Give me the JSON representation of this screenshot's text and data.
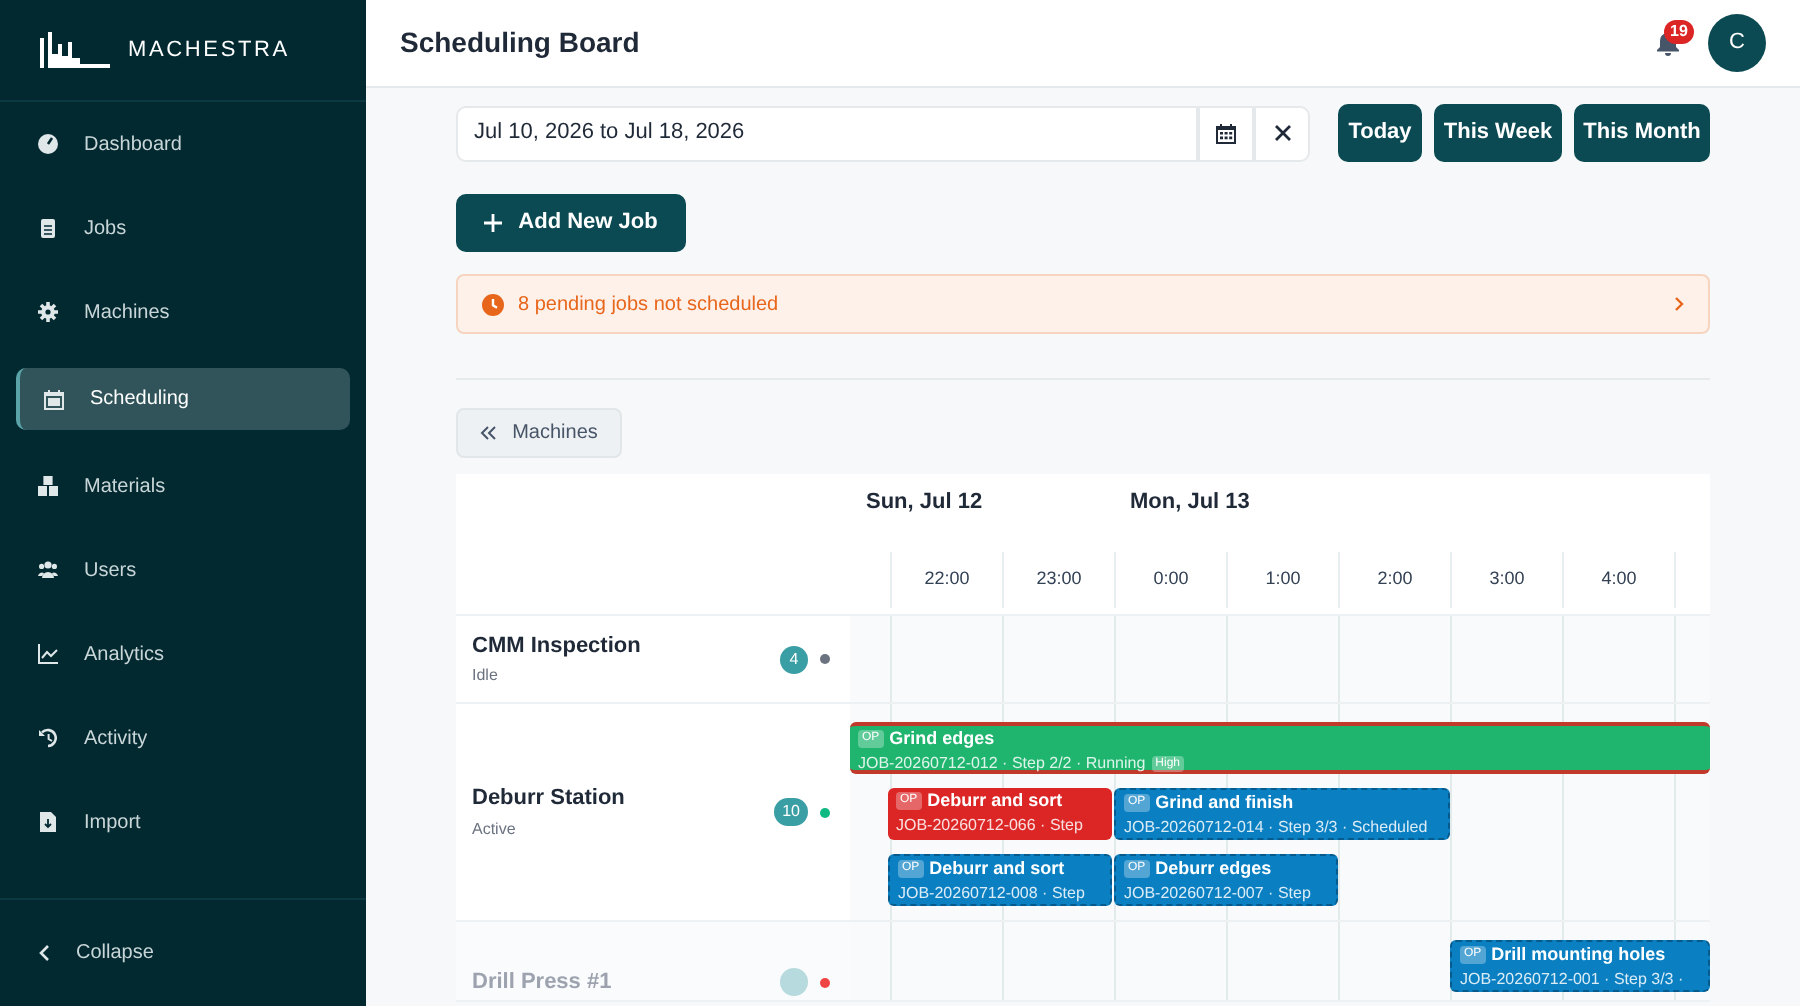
{
  "brand": "MACHESTRA",
  "nav": [
    {
      "label": "Dashboard",
      "selected": false
    },
    {
      "label": "Jobs",
      "selected": false
    },
    {
      "label": "Machines",
      "selected": false
    },
    {
      "label": "Scheduling",
      "selected": true
    },
    {
      "label": "Materials",
      "selected": false
    },
    {
      "label": "Users",
      "selected": false
    },
    {
      "label": "Analytics",
      "selected": false
    },
    {
      "label": "Activity",
      "selected": false
    },
    {
      "label": "Import",
      "selected": false
    }
  ],
  "collapse": "Collapse",
  "header": {
    "title": "Scheduling Board",
    "notifications": "19",
    "avatar": "C"
  },
  "date_range": {
    "value": "Jul 10, 2026 to Jul 18, 2026"
  },
  "range_buttons": [
    "Today",
    "This Week",
    "This Month"
  ],
  "add_button": "Add New Job",
  "pending_banner": "8 pending jobs not scheduled",
  "machines_toggle": "Machines",
  "timeline": {
    "days": [
      "Sun, Jul 12",
      "Mon, Jul 13"
    ],
    "hours": [
      "22:00",
      "23:00",
      "0:00",
      "1:00",
      "2:00",
      "3:00",
      "4:00"
    ]
  },
  "machines": [
    {
      "name": "CMM Inspection",
      "status": "Idle",
      "count": "4",
      "color": "#6b7280",
      "dimmed": false
    },
    {
      "name": "Deburr Station",
      "status": "Active",
      "count": "10",
      "color": "#10b981",
      "dimmed": false,
      "jobs": [
        {
          "tag": "OP",
          "title": "Grind edges",
          "detail": "JOB-20260712-012 · Step 2/2 · Running",
          "priority": "High",
          "kind": "running"
        },
        {
          "tag": "OP",
          "title": "Deburr and sort",
          "detail": "JOB-20260712-066 · Step",
          "kind": "late"
        },
        {
          "tag": "OP",
          "title": "Grind and finish",
          "detail": "JOB-20260712-014 · Step 3/3 · Scheduled",
          "kind": "scheduled"
        },
        {
          "tag": "OP",
          "title": "Deburr and sort",
          "detail": "JOB-20260712-008 · Step",
          "kind": "scheduled"
        },
        {
          "tag": "OP",
          "title": "Deburr edges",
          "detail": "JOB-20260712-007 · Step",
          "kind": "scheduled"
        }
      ]
    },
    {
      "name": "Drill Press #1",
      "color": "#ef4444",
      "dimmed": true,
      "jobs": [
        {
          "tag": "OP",
          "title": "Drill mounting holes",
          "detail": "JOB-20260712-001 · Step 3/3 ·",
          "kind": "scheduled"
        }
      ]
    }
  ]
}
